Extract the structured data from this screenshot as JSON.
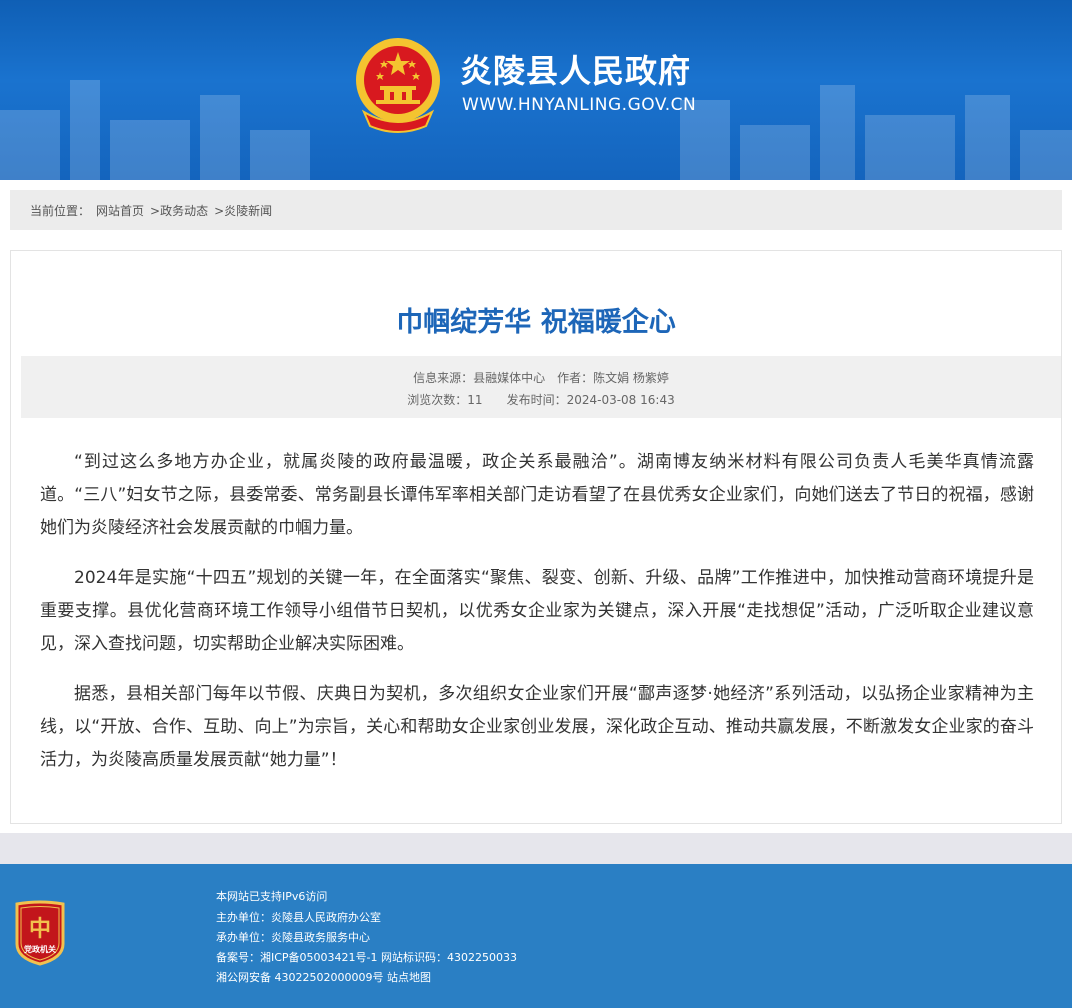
{
  "header": {
    "site_title": "炎陵县人民政府",
    "site_url": "WWW.HNYANLING.GOV.CN"
  },
  "breadcrumb": {
    "prefix": "当前位置：",
    "items": [
      "网站首页",
      ">政务动态",
      ">炎陵新闻"
    ]
  },
  "article": {
    "title": "巾帼绽芳华 祝福暖企心",
    "source_label": "信息来源：",
    "source_value": "县融媒体中心",
    "author_label": "作者：",
    "author_value": "陈文娟 杨紫婷",
    "views_label": "浏览次数：",
    "views_value": "11",
    "date_label": "发布时间：",
    "date_value": "2024-03-08 16:43",
    "paragraphs": [
      "“到过这么多地方办企业，就属炎陵的政府最温暖，政企关系最融洽”。湖南博友纳米材料有限公司负责人毛美华真情流露道。“三八”妇女节之际，县委常委、常务副县长谭伟军率相关部门走访看望了在县优秀女企业家们，向她们送去了节日的祝福，感谢她们为炎陵经济社会发展贡献的巾帼力量。",
      "2024年是实施“十四五”规划的关键一年，在全面落实“聚焦、裂变、创新、升级、品牌”工作推进中，加快推动营商环境提升是重要支撑。县优化营商环境工作领导小组借节日契机，以优秀女企业家为关键点，深入开展“走找想促”活动，广泛听取企业建议意见，深入查找问题，切实帮助企业解决实际困难。",
      "据悉，县相关部门每年以节假、庆典日为契机，多次组织女企业家们开展“酃声逐梦·她经济”系列活动，以弘扬企业家精神为主线，以“开放、合作、互助、向上”为宗旨，关心和帮助女企业家创业发展，深化政企互动、推动共赢发展，不断激发女企业家的奋斗活力，为炎陵高质量发展贡献“她力量”！"
    ]
  },
  "footer": {
    "badge_text": "党政机关",
    "lines": [
      "本网站已支持IPv6访问",
      "主办单位：炎陵县人民政府办公室",
      "承办单位：炎陵县政务服务中心",
      "备案号：湘ICP备05003421号-1 网站标识码：4302250033",
      "湘公网安备 43022502000009号 站点地图"
    ]
  },
  "colors": {
    "banner": "#1a73cf",
    "title": "#1d66b8",
    "footer": "#2a7fc4",
    "emblem_red": "#d8191f",
    "emblem_gold": "#f4c430"
  }
}
